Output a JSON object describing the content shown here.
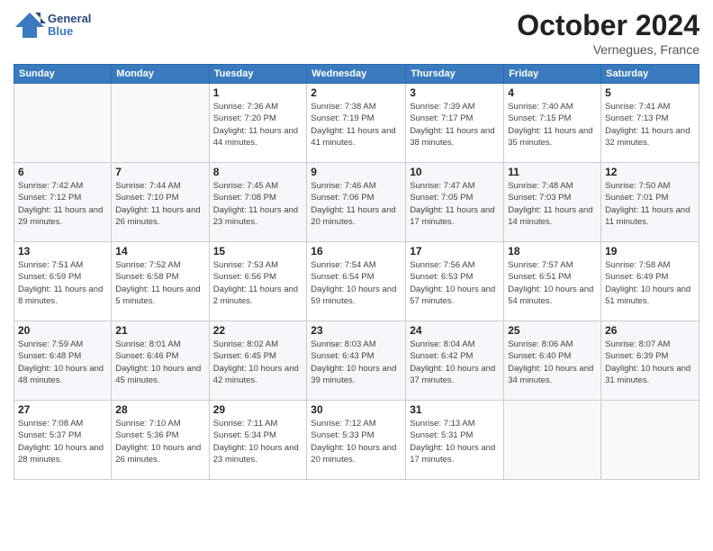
{
  "header": {
    "logo_general": "General",
    "logo_blue": "Blue",
    "month": "October 2024",
    "location": "Vernegues, France"
  },
  "days_of_week": [
    "Sunday",
    "Monday",
    "Tuesday",
    "Wednesday",
    "Thursday",
    "Friday",
    "Saturday"
  ],
  "weeks": [
    [
      {
        "day": "",
        "sunrise": "",
        "sunset": "",
        "daylight": ""
      },
      {
        "day": "",
        "sunrise": "",
        "sunset": "",
        "daylight": ""
      },
      {
        "day": "1",
        "sunrise": "Sunrise: 7:36 AM",
        "sunset": "Sunset: 7:20 PM",
        "daylight": "Daylight: 11 hours and 44 minutes."
      },
      {
        "day": "2",
        "sunrise": "Sunrise: 7:38 AM",
        "sunset": "Sunset: 7:19 PM",
        "daylight": "Daylight: 11 hours and 41 minutes."
      },
      {
        "day": "3",
        "sunrise": "Sunrise: 7:39 AM",
        "sunset": "Sunset: 7:17 PM",
        "daylight": "Daylight: 11 hours and 38 minutes."
      },
      {
        "day": "4",
        "sunrise": "Sunrise: 7:40 AM",
        "sunset": "Sunset: 7:15 PM",
        "daylight": "Daylight: 11 hours and 35 minutes."
      },
      {
        "day": "5",
        "sunrise": "Sunrise: 7:41 AM",
        "sunset": "Sunset: 7:13 PM",
        "daylight": "Daylight: 11 hours and 32 minutes."
      }
    ],
    [
      {
        "day": "6",
        "sunrise": "Sunrise: 7:42 AM",
        "sunset": "Sunset: 7:12 PM",
        "daylight": "Daylight: 11 hours and 29 minutes."
      },
      {
        "day": "7",
        "sunrise": "Sunrise: 7:44 AM",
        "sunset": "Sunset: 7:10 PM",
        "daylight": "Daylight: 11 hours and 26 minutes."
      },
      {
        "day": "8",
        "sunrise": "Sunrise: 7:45 AM",
        "sunset": "Sunset: 7:08 PM",
        "daylight": "Daylight: 11 hours and 23 minutes."
      },
      {
        "day": "9",
        "sunrise": "Sunrise: 7:46 AM",
        "sunset": "Sunset: 7:06 PM",
        "daylight": "Daylight: 11 hours and 20 minutes."
      },
      {
        "day": "10",
        "sunrise": "Sunrise: 7:47 AM",
        "sunset": "Sunset: 7:05 PM",
        "daylight": "Daylight: 11 hours and 17 minutes."
      },
      {
        "day": "11",
        "sunrise": "Sunrise: 7:48 AM",
        "sunset": "Sunset: 7:03 PM",
        "daylight": "Daylight: 11 hours and 14 minutes."
      },
      {
        "day": "12",
        "sunrise": "Sunrise: 7:50 AM",
        "sunset": "Sunset: 7:01 PM",
        "daylight": "Daylight: 11 hours and 11 minutes."
      }
    ],
    [
      {
        "day": "13",
        "sunrise": "Sunrise: 7:51 AM",
        "sunset": "Sunset: 6:59 PM",
        "daylight": "Daylight: 11 hours and 8 minutes."
      },
      {
        "day": "14",
        "sunrise": "Sunrise: 7:52 AM",
        "sunset": "Sunset: 6:58 PM",
        "daylight": "Daylight: 11 hours and 5 minutes."
      },
      {
        "day": "15",
        "sunrise": "Sunrise: 7:53 AM",
        "sunset": "Sunset: 6:56 PM",
        "daylight": "Daylight: 11 hours and 2 minutes."
      },
      {
        "day": "16",
        "sunrise": "Sunrise: 7:54 AM",
        "sunset": "Sunset: 6:54 PM",
        "daylight": "Daylight: 10 hours and 59 minutes."
      },
      {
        "day": "17",
        "sunrise": "Sunrise: 7:56 AM",
        "sunset": "Sunset: 6:53 PM",
        "daylight": "Daylight: 10 hours and 57 minutes."
      },
      {
        "day": "18",
        "sunrise": "Sunrise: 7:57 AM",
        "sunset": "Sunset: 6:51 PM",
        "daylight": "Daylight: 10 hours and 54 minutes."
      },
      {
        "day": "19",
        "sunrise": "Sunrise: 7:58 AM",
        "sunset": "Sunset: 6:49 PM",
        "daylight": "Daylight: 10 hours and 51 minutes."
      }
    ],
    [
      {
        "day": "20",
        "sunrise": "Sunrise: 7:59 AM",
        "sunset": "Sunset: 6:48 PM",
        "daylight": "Daylight: 10 hours and 48 minutes."
      },
      {
        "day": "21",
        "sunrise": "Sunrise: 8:01 AM",
        "sunset": "Sunset: 6:46 PM",
        "daylight": "Daylight: 10 hours and 45 minutes."
      },
      {
        "day": "22",
        "sunrise": "Sunrise: 8:02 AM",
        "sunset": "Sunset: 6:45 PM",
        "daylight": "Daylight: 10 hours and 42 minutes."
      },
      {
        "day": "23",
        "sunrise": "Sunrise: 8:03 AM",
        "sunset": "Sunset: 6:43 PM",
        "daylight": "Daylight: 10 hours and 39 minutes."
      },
      {
        "day": "24",
        "sunrise": "Sunrise: 8:04 AM",
        "sunset": "Sunset: 6:42 PM",
        "daylight": "Daylight: 10 hours and 37 minutes."
      },
      {
        "day": "25",
        "sunrise": "Sunrise: 8:06 AM",
        "sunset": "Sunset: 6:40 PM",
        "daylight": "Daylight: 10 hours and 34 minutes."
      },
      {
        "day": "26",
        "sunrise": "Sunrise: 8:07 AM",
        "sunset": "Sunset: 6:39 PM",
        "daylight": "Daylight: 10 hours and 31 minutes."
      }
    ],
    [
      {
        "day": "27",
        "sunrise": "Sunrise: 7:08 AM",
        "sunset": "Sunset: 5:37 PM",
        "daylight": "Daylight: 10 hours and 28 minutes."
      },
      {
        "day": "28",
        "sunrise": "Sunrise: 7:10 AM",
        "sunset": "Sunset: 5:36 PM",
        "daylight": "Daylight: 10 hours and 26 minutes."
      },
      {
        "day": "29",
        "sunrise": "Sunrise: 7:11 AM",
        "sunset": "Sunset: 5:34 PM",
        "daylight": "Daylight: 10 hours and 23 minutes."
      },
      {
        "day": "30",
        "sunrise": "Sunrise: 7:12 AM",
        "sunset": "Sunset: 5:33 PM",
        "daylight": "Daylight: 10 hours and 20 minutes."
      },
      {
        "day": "31",
        "sunrise": "Sunrise: 7:13 AM",
        "sunset": "Sunset: 5:31 PM",
        "daylight": "Daylight: 10 hours and 17 minutes."
      },
      {
        "day": "",
        "sunrise": "",
        "sunset": "",
        "daylight": ""
      },
      {
        "day": "",
        "sunrise": "",
        "sunset": "",
        "daylight": ""
      }
    ]
  ]
}
